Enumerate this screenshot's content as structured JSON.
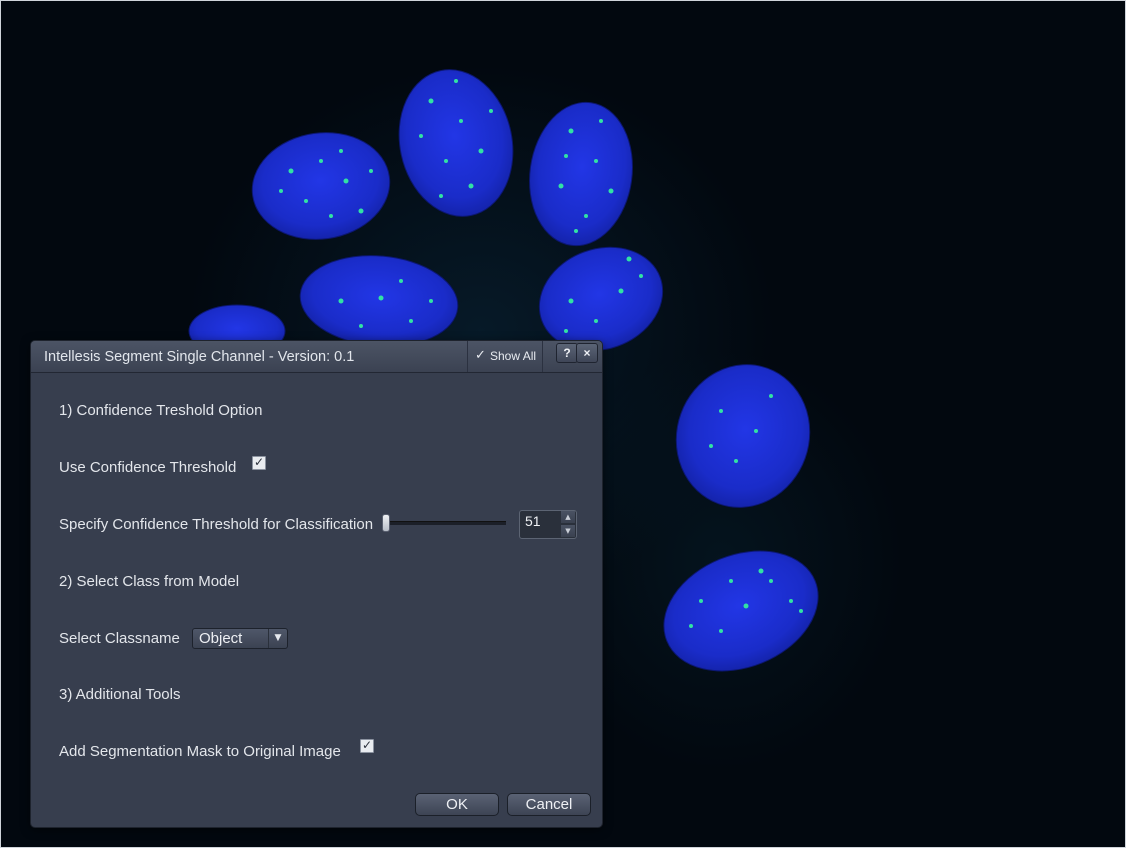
{
  "dialog": {
    "title": "Intellesis Segment Single Channel - Version: 0.1",
    "show_all_label": "Show All",
    "help_label": "?",
    "close_label": "×"
  },
  "sections": {
    "confidence_header": "1) Confidence Treshold Option",
    "use_confidence_label": "Use Confidence Threshold",
    "use_confidence_checked": true,
    "specify_threshold_label": "Specify Confidence Threshold for Classification",
    "threshold_value": "51",
    "class_header": "2) Select Class from Model",
    "select_classname_label": "Select Classname",
    "classname_value": "Object",
    "tools_header": "3) Additional Tools",
    "add_mask_label": "Add Segmentation Mask to Original Image",
    "add_mask_checked": true
  },
  "buttons": {
    "ok": "OK",
    "cancel": "Cancel"
  },
  "colors": {
    "dialog_bg": "#373e4e",
    "nucleus_blue": "#1a2fd6",
    "spot_green": "#2de0a0"
  }
}
